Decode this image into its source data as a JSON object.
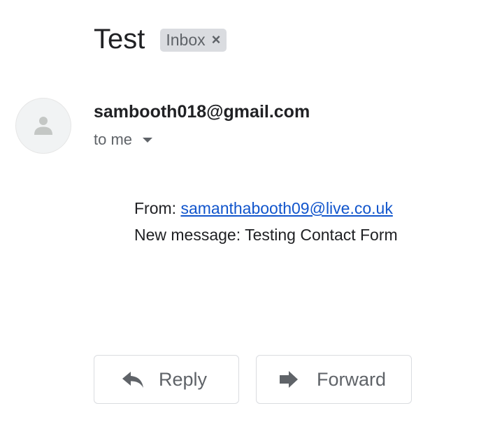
{
  "email": {
    "subject": "Test",
    "label": "Inbox",
    "label_remove_glyph": "×",
    "sender": "sambooth018@gmail.com",
    "recipient": "to me",
    "body": {
      "from_label": "From:",
      "from_link": "samanthabooth09@live.co.uk",
      "message_line": "New message: Testing Contact Form"
    }
  },
  "actions": {
    "reply_label": "Reply",
    "forward_label": "Forward"
  },
  "icons": {
    "avatar": "person-icon",
    "recipient_details": "caret-down-icon",
    "reply": "reply-arrow-icon",
    "forward": "forward-arrow-icon"
  },
  "colors": {
    "text_primary": "#202124",
    "text_secondary": "#5f6368",
    "link": "#1155cc",
    "chip_background": "#dadce0",
    "button_border": "#dadce0",
    "avatar_background": "#f1f3f4"
  }
}
